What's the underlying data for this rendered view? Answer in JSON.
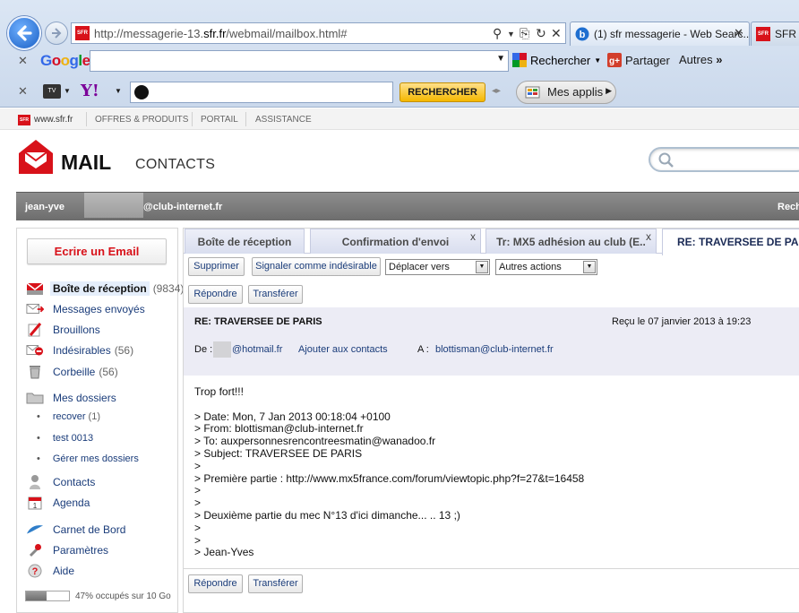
{
  "browser": {
    "url_prefix": "http://messagerie-13.",
    "url_domain": "sfr.fr",
    "url_suffix": "/webmail/mailbox.html#",
    "tabs": [
      {
        "label": "(1) sfr messagerie - Web Searc..."
      },
      {
        "label": "SFR M"
      }
    ],
    "google_toolbar": {
      "logo": "Google",
      "search_label": "Rechercher",
      "share_label": "Partager",
      "more_label": "Autres"
    },
    "yahoo_toolbar": {
      "tv_label": "TV",
      "logo": "Y!",
      "search_button": "RECHERCHER",
      "apps_label": "Mes applis"
    }
  },
  "sfr_topbar": {
    "site": "www.sfr.fr",
    "links": [
      "OFFRES & PRODUITS",
      "PORTAIL",
      "ASSISTANCE"
    ]
  },
  "header": {
    "title": "MAIL",
    "contacts_link": "CONTACTS"
  },
  "userbar": {
    "user_prefix": "jean-yve",
    "user_suffix": "@club-internet.fr",
    "right_text": "Rech"
  },
  "sidebar": {
    "compose": "Ecrire un Email",
    "folders": [
      {
        "label": "Boîte de réception",
        "count": "(9834)"
      },
      {
        "label": "Messages envoyés",
        "count": ""
      },
      {
        "label": "Brouillons",
        "count": ""
      },
      {
        "label": "Indésirables",
        "count": "(56)"
      },
      {
        "label": "Corbeille",
        "count": "(56)"
      },
      {
        "label": "Mes dossiers",
        "count": ""
      }
    ],
    "subfolders": [
      {
        "label": "recover",
        "count": "(1)"
      },
      {
        "label": "test 0013",
        "count": ""
      },
      {
        "label": "Gérer mes dossiers",
        "count": ""
      }
    ],
    "tools": [
      {
        "label": "Contacts"
      },
      {
        "label": "Agenda"
      },
      {
        "label": "Carnet de Bord"
      },
      {
        "label": "Paramètres"
      },
      {
        "label": "Aide"
      }
    ],
    "quota": {
      "fraction": 0.47,
      "text": "47% occupés sur 10 Go"
    }
  },
  "main": {
    "tabs": [
      {
        "label": "Boîte de réception"
      },
      {
        "label": "Confirmation d'envoi"
      },
      {
        "label": "Tr: MX5 adhésion au club (E.."
      },
      {
        "label": "RE: TRAVERSEE DE PARIS"
      }
    ],
    "toolbar": {
      "delete": "Supprimer",
      "spam": "Signaler comme indésirable",
      "move": "Déplacer vers",
      "other": "Autres actions"
    },
    "reply": "Répondre",
    "forward": "Transférer",
    "message": {
      "subject": "RE: TRAVERSEE DE PARIS",
      "received": "Reçu le 07 janvier 2013 à 19:23",
      "from_label": "De :",
      "from_value": "@hotmail.fr",
      "add_contact": "Ajouter aux contacts",
      "to_label": "A :",
      "to_value": "blottisman@club-internet.fr",
      "body": "Trop fort!!!\n\n> Date: Mon, 7 Jan 2013 00:18:04 +0100\n> From: blottisman@club-internet.fr\n> To: auxpersonnesrencontreesmatin@wanadoo.fr\n> Subject: TRAVERSEE DE PARIS\n>\n> Première partie : http://www.mx5france.com/forum/viewtopic.php?f=27&t=16458\n>\n>\n> Deuxième partie du mec N°13 d'ici dimanche... .. 13 ;)\n>\n>\n> Jean-Yves"
    }
  }
}
